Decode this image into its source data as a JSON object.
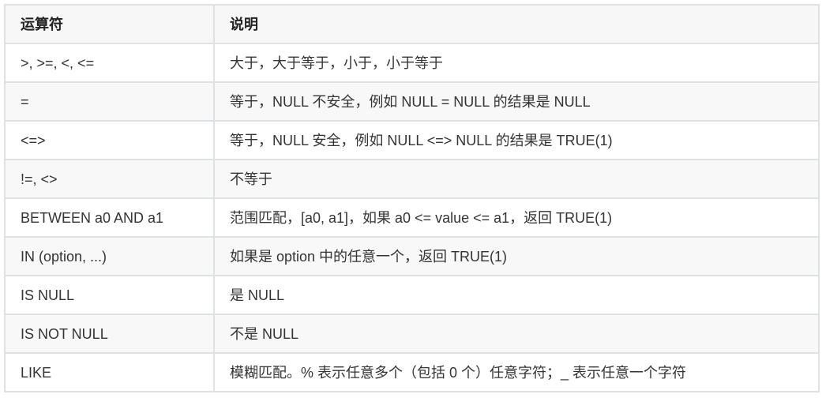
{
  "table": {
    "headers": [
      "运算符",
      "说明"
    ],
    "rows": [
      {
        "operator": ">, >=, <, <=",
        "description": "大于，大于等于，小于，小于等于"
      },
      {
        "operator": "=",
        "description": "等于，NULL 不安全，例如 NULL = NULL 的结果是 NULL"
      },
      {
        "operator": "<=>",
        "description": "等于，NULL 安全，例如 NULL <=> NULL 的结果是 TRUE(1)"
      },
      {
        "operator": "!=, <>",
        "description": "不等于"
      },
      {
        "operator": "BETWEEN a0 AND a1",
        "description": "范围匹配，[a0, a1]，如果 a0 <= value <= a1，返回 TRUE(1)"
      },
      {
        "operator": "IN (option, ...)",
        "description": "如果是 option 中的任意一个，返回 TRUE(1)"
      },
      {
        "operator": "IS NULL",
        "description": "是 NULL"
      },
      {
        "operator": "IS NOT NULL",
        "description": "不是 NULL"
      },
      {
        "operator": "LIKE",
        "description": "模糊匹配。% 表示任意多个（包括 0 个）任意字符；_ 表示任意一个字符"
      }
    ]
  }
}
